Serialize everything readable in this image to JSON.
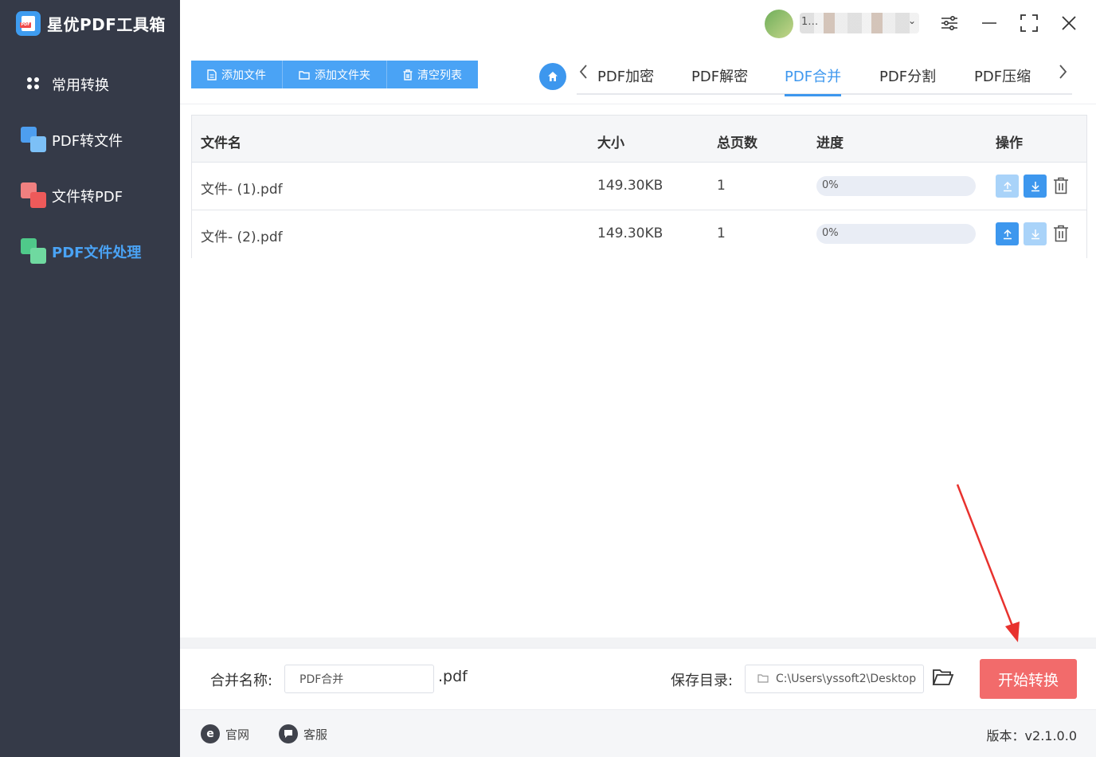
{
  "app": {
    "title": "星优PDF工具箱",
    "logo_tag": "PDF"
  },
  "sidebar": {
    "items": [
      {
        "label": "常用转换",
        "icon": "apps-icon"
      },
      {
        "label": "PDF转文件",
        "icon": "pdf-to-file-icon"
      },
      {
        "label": "文件转PDF",
        "icon": "file-to-pdf-icon"
      },
      {
        "label": "PDF文件处理",
        "icon": "pdf-processing-icon",
        "active": true
      }
    ]
  },
  "user": {
    "name": "1…",
    "caret": "⌄"
  },
  "toolbar": {
    "add_file": "添加文件",
    "add_folder": "添加文件夹",
    "clear_list": "清空列表"
  },
  "tabs": {
    "items": [
      "PDF加密",
      "PDF解密",
      "PDF合并",
      "PDF分割",
      "PDF压缩"
    ],
    "active_index": 2
  },
  "table": {
    "headers": {
      "filename": "文件名",
      "size": "大小",
      "pages": "总页数",
      "progress": "进度",
      "actions": "操作"
    },
    "rows": [
      {
        "filename": "文件- (1).pdf",
        "size": "149.30KB",
        "pages": "1",
        "progress_text": "0%",
        "progress_value": 0,
        "up_enabled": false,
        "down_enabled": true
      },
      {
        "filename": "文件- (2).pdf",
        "size": "149.30KB",
        "pages": "1",
        "progress_text": "0%",
        "progress_value": 0,
        "up_enabled": true,
        "down_enabled": false
      }
    ]
  },
  "settings": {
    "merge_name_label": "合并名称:",
    "merge_name_value": "PDF合并",
    "extension": ".pdf",
    "save_dir_label": "保存目录:",
    "save_dir_value": "C:\\Users\\yssoft2\\Desktop",
    "start_button": "开始转换"
  },
  "footer": {
    "website": "官网",
    "service": "客服",
    "version": "版本：v2.1.0.0"
  },
  "colors": {
    "sidebar_bg": "#353a48",
    "accent": "#3d97ee",
    "start_button": "#f26b6b",
    "annotation_arrow": "#e8322e"
  }
}
